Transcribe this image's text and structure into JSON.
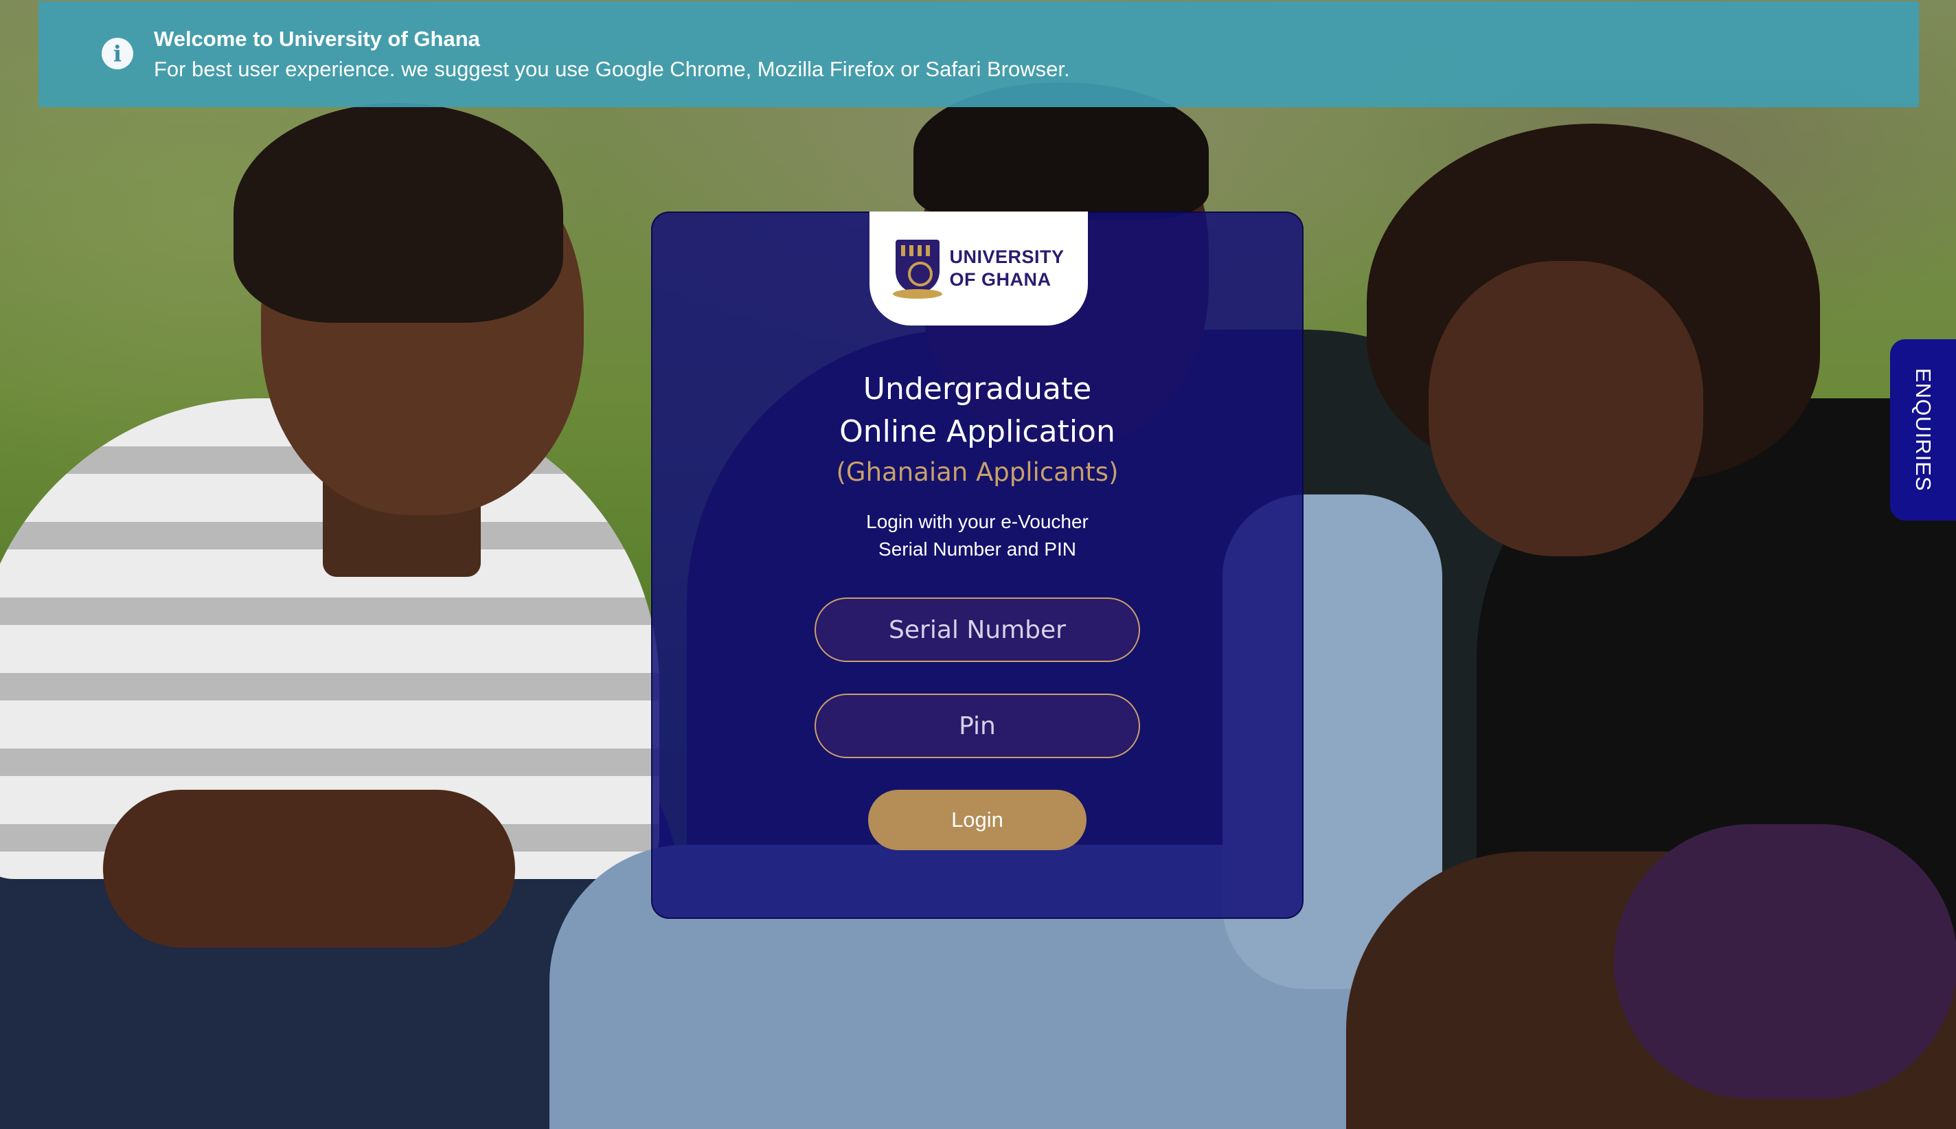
{
  "banner": {
    "icon": "info-icon",
    "title": "Welcome to University of Ghana",
    "message": "For best user experience. we suggest you use Google Chrome, Mozilla Firefox or Safari Browser."
  },
  "logo": {
    "line1": "UNIVERSITY",
    "line2": "OF GHANA"
  },
  "login_card": {
    "title_line1": "Undergraduate",
    "title_line2": "Online Application",
    "subtitle": "(Ghanaian Applicants)",
    "instruction_line1": "Login with your e-Voucher",
    "instruction_line2": "Serial Number and PIN",
    "serial_placeholder": "Serial Number",
    "serial_value": "",
    "pin_placeholder": "Pin",
    "pin_value": "",
    "login_label": "Login"
  },
  "enquiries": {
    "label": "ENQUIRIES"
  },
  "colors": {
    "banner": "#409EB2",
    "card": "#120E78",
    "accent_gold": "#C9A06A",
    "button": "#B48D57",
    "enquiries_tab": "#12108C"
  }
}
